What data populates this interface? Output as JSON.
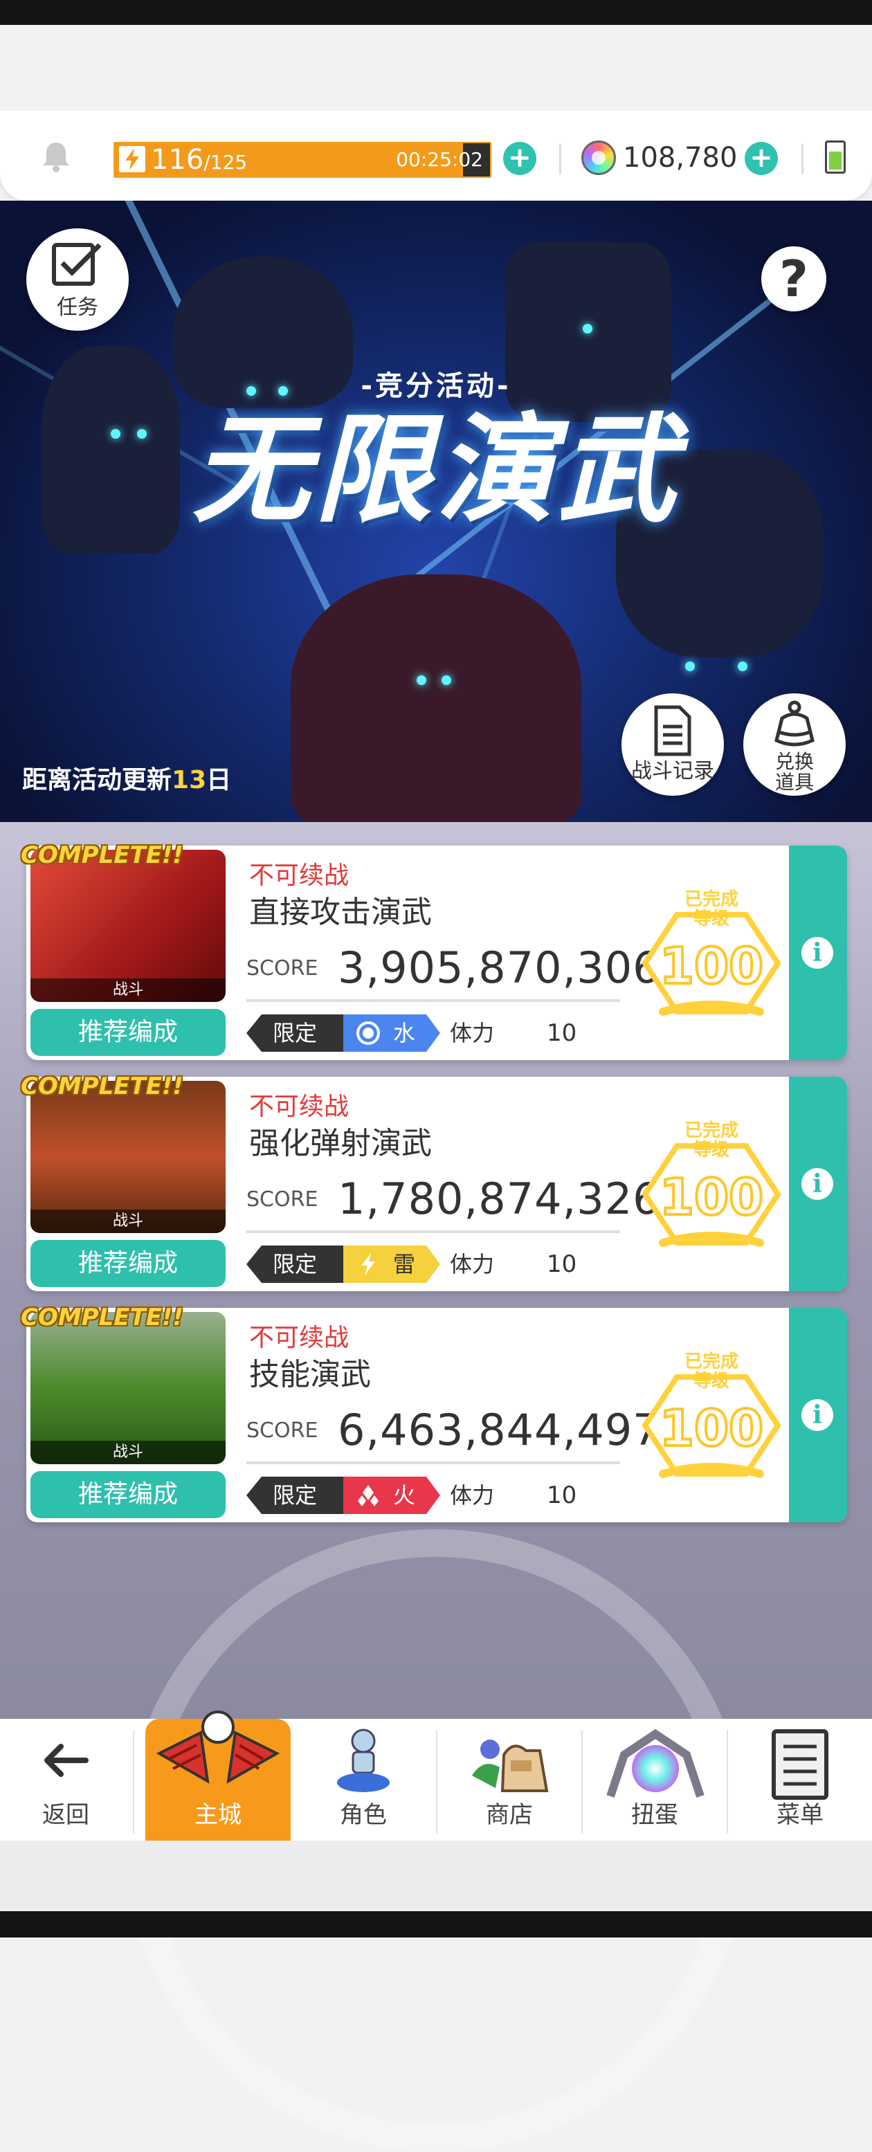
{
  "hud": {
    "stamina_current": "116",
    "stamina_max": "/125",
    "stamina_fraction": 0.928,
    "timer": "00:25:02",
    "gems": "108,780"
  },
  "banner": {
    "subtitle": "-竞分活动-",
    "title": "无限演武",
    "countdown_prefix": "距离活动更新",
    "countdown_days": "13",
    "countdown_suffix": "日",
    "tasks_label": "任务",
    "battle_log_label": "战斗记录",
    "exchange_label_1": "兑换",
    "exchange_label_2": "道具"
  },
  "stages": [
    {
      "complete": "COMPLETE!!",
      "thumb_label": "战斗",
      "status": "不可续战",
      "name": "直接攻击演武",
      "score_label": "SCORE",
      "score": "3,905,870,306",
      "limit": "限定",
      "element": "水",
      "element_color": "#4b86f0",
      "stamina_label": "体力",
      "stamina": "10",
      "badge_line1": "已完成",
      "badge_line2": "等级",
      "badge_level": "100",
      "recommend": "推荐编成"
    },
    {
      "complete": "COMPLETE!!",
      "thumb_label": "战斗",
      "status": "不可续战",
      "name": "强化弹射演武",
      "score_label": "SCORE",
      "score": "1,780,874,326",
      "limit": "限定",
      "element": "雷",
      "element_color": "#f5d13d",
      "stamina_label": "体力",
      "stamina": "10",
      "badge_line1": "已完成",
      "badge_line2": "等级",
      "badge_level": "100",
      "recommend": "推荐编成"
    },
    {
      "complete": "COMPLETE!!",
      "thumb_label": "战斗",
      "status": "不可续战",
      "name": "技能演武",
      "score_label": "SCORE",
      "score": "6,463,844,497",
      "limit": "限定",
      "element": "火",
      "element_color": "#e8364a",
      "stamina_label": "体力",
      "stamina": "10",
      "badge_line1": "已完成",
      "badge_line2": "等级",
      "badge_level": "100",
      "recommend": "推荐编成"
    }
  ],
  "nav": {
    "back": "返回",
    "main_city": "主城",
    "character": "角色",
    "shop": "商店",
    "gacha": "扭蛋",
    "menu": "菜单"
  },
  "colors": {
    "accent_teal": "#2ec0ad",
    "stamina_orange": "#f49a1a",
    "nav_active": "#f79a1b"
  }
}
